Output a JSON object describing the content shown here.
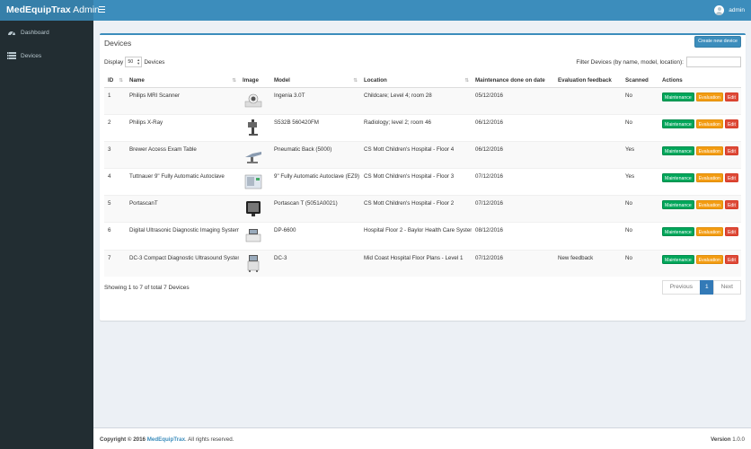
{
  "header": {
    "brand_bold": "MedEquipTrax",
    "brand_light": "Admin",
    "user_name": "admin"
  },
  "sidebar": {
    "items": [
      {
        "label": "Dashboard",
        "icon": "dashboard-icon"
      },
      {
        "label": "Devices",
        "icon": "devices-list-icon"
      }
    ]
  },
  "devices": {
    "title": "Devices",
    "create_label": "Create new device",
    "display_label": "Display",
    "display_value": "50",
    "display_suffix": "Devices",
    "filter_label": "Filter Devices (by name, model, location):",
    "filter_value": "",
    "columns": [
      "ID",
      "Name",
      "Image",
      "Model",
      "Location",
      "Maintenance done on date",
      "Evaluation feedback",
      "Scanned",
      "Actions"
    ],
    "rows": [
      {
        "id": "1",
        "name": "Philips MRI Scanner",
        "image": "mri-scanner-image",
        "model": "Ingenia 3.0T",
        "location": "Childcare; Level 4; room 28",
        "date": "05/12/2016",
        "feedback": "",
        "scanned": "No"
      },
      {
        "id": "2",
        "name": "Philips X-Ray",
        "image": "xray-machine-image",
        "model": "S532B 560420FM",
        "location": "Radiology; level 2; room 46",
        "date": "06/12/2016",
        "feedback": "",
        "scanned": "No"
      },
      {
        "id": "3",
        "name": "Brewer Access Exam Table",
        "image": "exam-table-image",
        "model": "Pneumatic Back (5000)",
        "location": "CS Mott Children's Hospital - Floor 4",
        "date": "06/12/2016",
        "feedback": "",
        "scanned": "Yes"
      },
      {
        "id": "4",
        "name": "Tuttnauer 9\" Fully Automatic Autoclave",
        "image": "autoclave-image",
        "model": "9\" Fully Automatic Autoclave (EZ9)",
        "location": "CS Mott Children's Hospital - Floor 3",
        "date": "07/12/2016",
        "feedback": "",
        "scanned": "Yes"
      },
      {
        "id": "5",
        "name": "PortascanT",
        "image": "portable-monitor-image",
        "model": "Portascan T (5051A0021)",
        "location": "CS Mott Children's Hospital - Floor 2",
        "date": "07/12/2016",
        "feedback": "",
        "scanned": "No"
      },
      {
        "id": "6",
        "name": "Digital Ultrasonic Diagnostic Imaging System",
        "image": "ultrasound-unit-image",
        "model": "DP-6600",
        "location": "Hospital Floor 2 - Baylor Health Care System",
        "date": "08/12/2016",
        "feedback": "",
        "scanned": "No"
      },
      {
        "id": "7",
        "name": "DC-3 Compact Diagnostic Ultrasound System",
        "image": "ultrasound-cart-image",
        "model": "DC-3",
        "location": "Mid Coast Hospital Floor Plans - Level 1",
        "date": "07/12/2016",
        "feedback": "New feedback",
        "scanned": "No"
      }
    ],
    "actions": {
      "maintenance": "Maintenance",
      "evaluation": "Evaluation",
      "edit": "Edit"
    },
    "info": "Showing 1 to 7 of total 7 Devices",
    "pager": {
      "previous": "Previous",
      "page": "1",
      "next": "Next"
    }
  },
  "footer": {
    "copyright_prefix": "Copyright © 2016",
    "company": "MedEquipTrax",
    "rights": ". All rights reserved.",
    "version_label": "Version",
    "version_value": "1.0.0"
  },
  "colors": {
    "header": "#3c8dbc",
    "brand": "#367fa9",
    "sidebar": "#222d32",
    "maintenance": "#00a65a",
    "evaluation": "#f39c12",
    "edit": "#dd4b39"
  }
}
